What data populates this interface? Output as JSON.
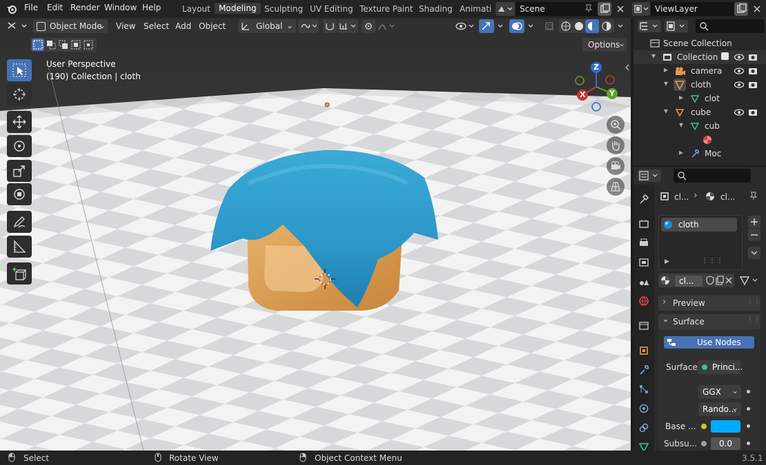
{
  "top_menu": {
    "file": "File",
    "edit": "Edit",
    "render": "Render",
    "window": "Window",
    "help": "Help"
  },
  "workspaces": [
    "Layout",
    "Modeling",
    "Sculpting",
    "UV Editing",
    "Texture Paint",
    "Shading",
    "Animati"
  ],
  "active_workspace": "Modeling",
  "scene_field": "Scene",
  "viewlayer_field": "ViewLayer",
  "viewport_header": {
    "mode": "Object Mode",
    "view": "View",
    "select": "Select",
    "add": "Add",
    "object": "Object",
    "transform_orientation": "Global",
    "options": "Options"
  },
  "viewport": {
    "perspective": "User Perspective",
    "context": "(190) Collection | cloth"
  },
  "gizmo": {
    "z": "Z",
    "y": "Y",
    "x": "X"
  },
  "outliner": {
    "scene_collection": "Scene Collection",
    "collection": "Collection",
    "camera": "camera",
    "cloth": "cloth",
    "cloth_mesh": "clot",
    "cube": "cube",
    "cube_mesh": "cub",
    "modifier": "Moc"
  },
  "properties": {
    "breadcrumb_obj": "cl...",
    "breadcrumb_mat": "cl...",
    "material_slot": "cloth",
    "material_name": "cl...",
    "preview": "Preview",
    "surface_panel": "Surface",
    "use_nodes": "Use Nodes",
    "surface_label": "Surface",
    "surface_value": "Princi...",
    "distribution": "GGX",
    "subsurface_method": "Rando...",
    "base_color_label": "Base ...",
    "subsurface_label": "Subsu...",
    "subsurface_value": "0.0",
    "base_color": "#00aaff"
  },
  "status": {
    "select": "Select",
    "rotate": "Rotate View",
    "context_menu": "Object Context Menu",
    "version": "3.5.1"
  }
}
